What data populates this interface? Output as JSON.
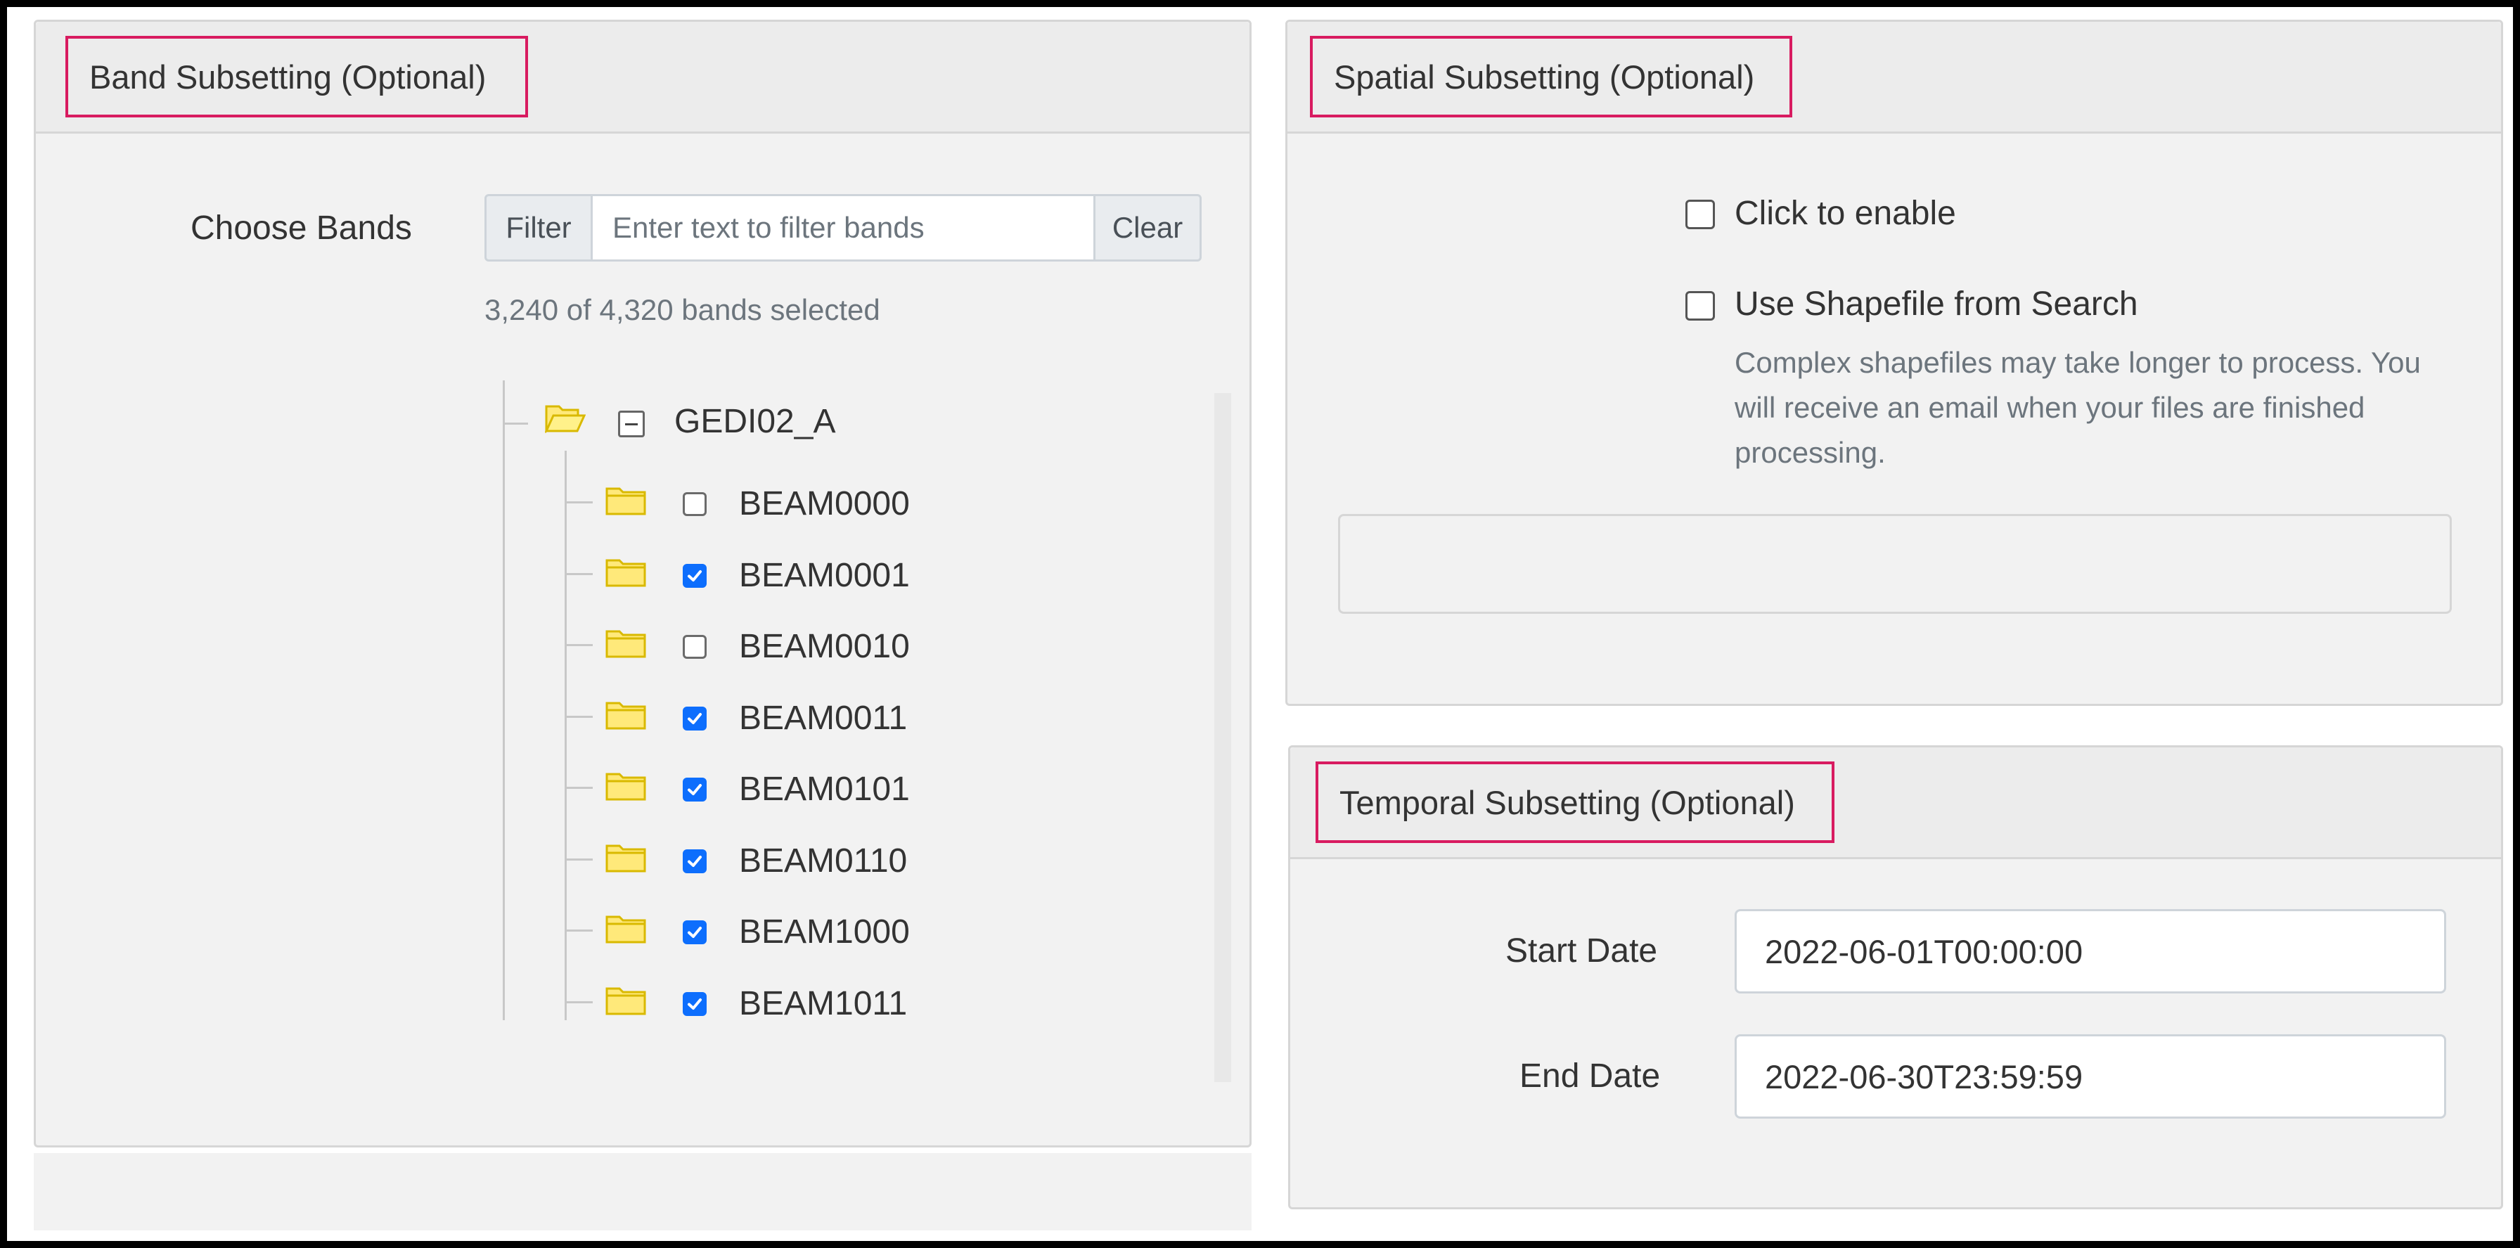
{
  "band_panel": {
    "title": "Band Subsetting (Optional)",
    "choose_label": "Choose Bands",
    "filter_label": "Filter",
    "filter_placeholder": "Enter text to filter bands",
    "filter_value": "",
    "clear_label": "Clear",
    "selected_count": "3,240 of 4,320 bands selected",
    "tree": {
      "root": {
        "label": "GEDI02_A",
        "expanded": true,
        "icon": "folder-open-icon"
      },
      "children": [
        {
          "label": "BEAM0000",
          "checked": false,
          "icon": "folder-icon"
        },
        {
          "label": "BEAM0001",
          "checked": true,
          "icon": "folder-icon"
        },
        {
          "label": "BEAM0010",
          "checked": false,
          "icon": "folder-icon"
        },
        {
          "label": "BEAM0011",
          "checked": true,
          "icon": "folder-icon"
        },
        {
          "label": "BEAM0101",
          "checked": true,
          "icon": "folder-icon"
        },
        {
          "label": "BEAM0110",
          "checked": true,
          "icon": "folder-icon"
        },
        {
          "label": "BEAM1000",
          "checked": true,
          "icon": "folder-icon"
        },
        {
          "label": "BEAM1011",
          "checked": true,
          "icon": "folder-icon"
        }
      ]
    }
  },
  "spatial_panel": {
    "title": "Spatial Subsetting (Optional)",
    "enable_label": "Click to enable",
    "enable_checked": false,
    "shapefile_label": "Use Shapefile from Search",
    "shapefile_checked": false,
    "help_text": "Complex shapefiles may take longer to process. You will receive an email when your files are finished processing."
  },
  "temporal_panel": {
    "title": "Temporal Subsetting (Optional)",
    "start_label": "Start Date",
    "start_value": "2022-06-01T00:00:00",
    "end_label": "End Date",
    "end_value": "2022-06-30T23:59:59"
  },
  "colors": {
    "highlight_border": "#d81b60",
    "checkbox_checked": "#0d6efd",
    "folder_fill": "#ffe97a",
    "folder_stroke": "#d9b900"
  }
}
